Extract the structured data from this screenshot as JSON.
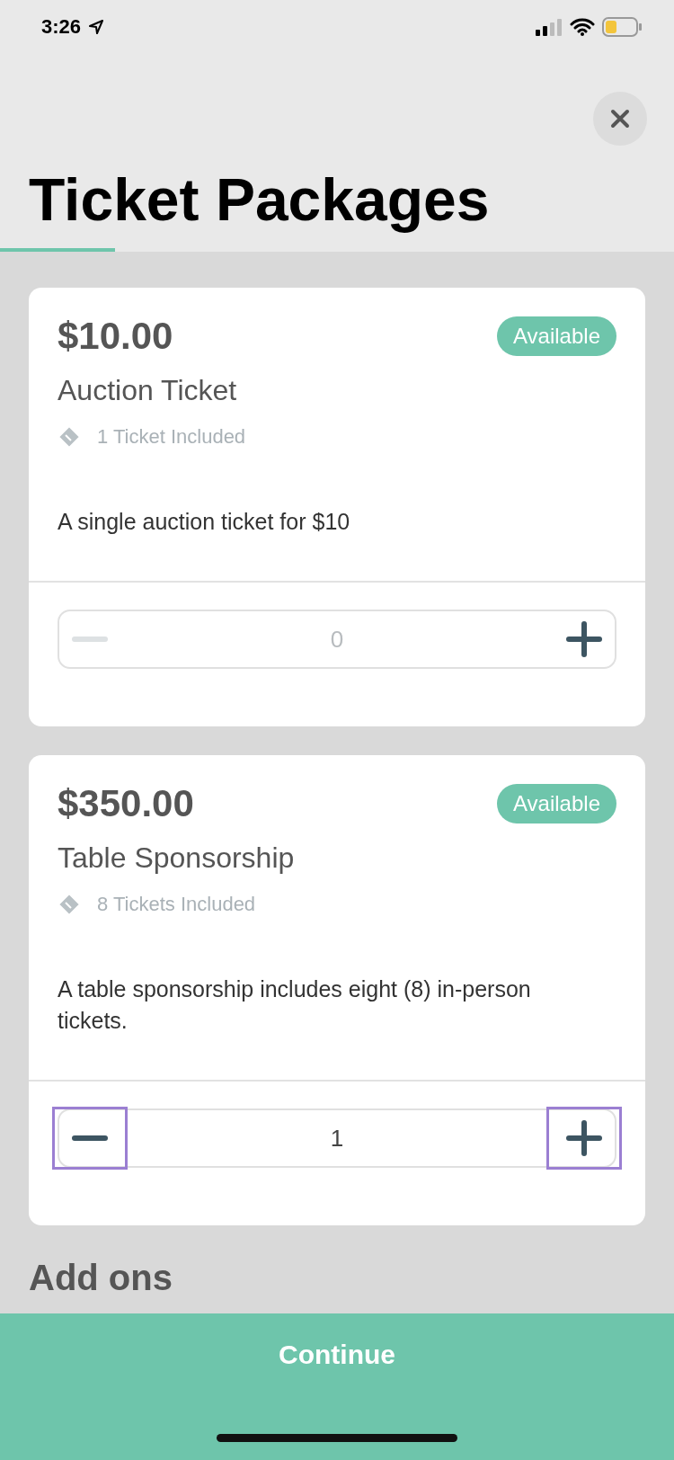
{
  "status_bar": {
    "time": "3:26"
  },
  "header": {
    "title": "Ticket Packages",
    "progress": {
      "level": 0.17
    }
  },
  "packages": [
    {
      "price": "$10.00",
      "badge": "Available",
      "name": "Auction Ticket",
      "tickets": "1 Ticket Included",
      "description": "A single auction ticket for $10",
      "quantity": "0",
      "minus_disabled": true,
      "highlighted": false
    },
    {
      "price": "$350.00",
      "badge": "Available",
      "name": "Table Sponsorship",
      "tickets": "8 Tickets Included",
      "description": "A table sponsorship includes eight (8) in-person tickets.",
      "quantity": "1",
      "minus_disabled": false,
      "highlighted": true
    }
  ],
  "add_ons": {
    "heading": "Add ons"
  },
  "footer": {
    "button": "Continue"
  }
}
